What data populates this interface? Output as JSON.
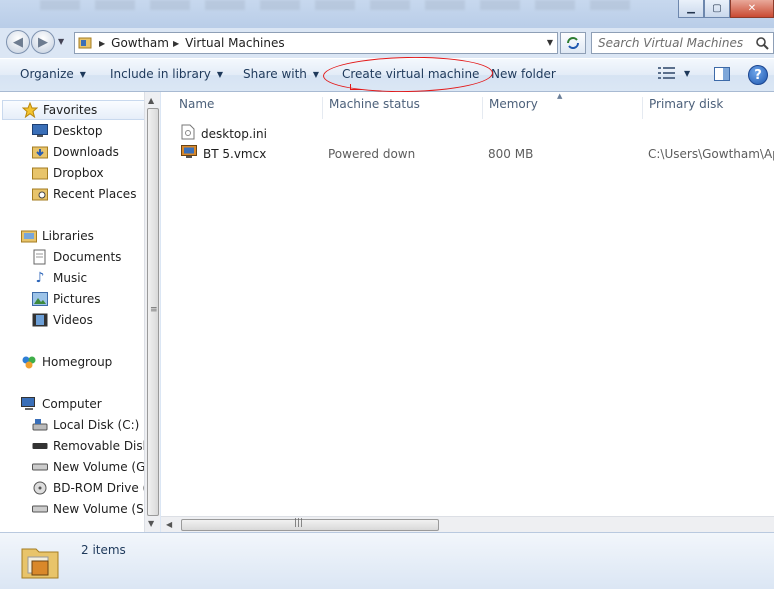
{
  "address": {
    "crumbs": [
      "Gowtham",
      "Virtual Machines"
    ]
  },
  "search": {
    "placeholder": "Search Virtual Machines"
  },
  "toolbar": {
    "organize": "Organize",
    "include_in_library": "Include in library",
    "share_with": "Share with",
    "create_virtual_machine": "Create virtual machine",
    "new_folder": "New folder"
  },
  "annotation": {
    "color": "#e31a1a",
    "shape": "hand-drawn ellipse around Create virtual machine"
  },
  "navigation": {
    "favorites": {
      "label": "Favorites",
      "items": [
        {
          "label": "Desktop",
          "icon": "desktop-icon"
        },
        {
          "label": "Downloads",
          "icon": "downloads-folder-icon"
        },
        {
          "label": "Dropbox",
          "icon": "dropbox-folder-icon"
        },
        {
          "label": "Recent Places",
          "icon": "recent-places-icon"
        }
      ]
    },
    "libraries": {
      "label": "Libraries",
      "items": [
        {
          "label": "Documents",
          "icon": "documents-icon"
        },
        {
          "label": "Music",
          "icon": "music-icon"
        },
        {
          "label": "Pictures",
          "icon": "pictures-icon"
        },
        {
          "label": "Videos",
          "icon": "videos-icon"
        }
      ]
    },
    "homegroup": {
      "label": "Homegroup"
    },
    "computer": {
      "label": "Computer",
      "items": [
        {
          "label": "Local Disk (C:)",
          "icon": "local-disk-icon"
        },
        {
          "label": "Removable Disk (",
          "icon": "removable-disk-icon"
        },
        {
          "label": "New Volume (G:)",
          "icon": "drive-icon"
        },
        {
          "label": "BD-ROM Drive (J:",
          "icon": "bd-rom-icon"
        },
        {
          "label": "New Volume (S:)",
          "icon": "drive-icon"
        }
      ]
    }
  },
  "file_list": {
    "columns": [
      "Name",
      "Machine status",
      "Memory",
      "Primary disk"
    ],
    "rows": [
      {
        "name": "desktop.ini",
        "status": "",
        "memory": "",
        "disk": "",
        "icon": "ini-file-icon"
      },
      {
        "name": "BT 5.vmcx",
        "status": "Powered down",
        "memory": "800 MB",
        "disk": "C:\\Users\\Gowtham\\App",
        "icon": "virtual-machine-icon"
      }
    ]
  },
  "details": {
    "item_count": "2 items"
  },
  "colors": {
    "accent": "#1e395b",
    "window_frame": "#dbe6f4"
  }
}
